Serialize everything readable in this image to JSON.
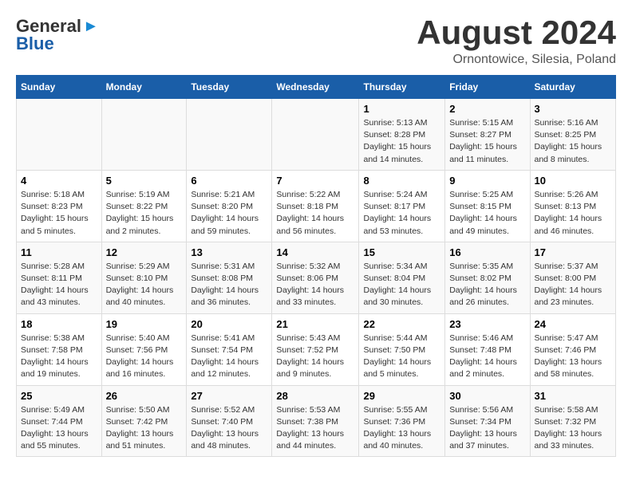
{
  "header": {
    "logo_general": "General",
    "logo_blue": "Blue",
    "month_year": "August 2024",
    "location": "Ornontowice, Silesia, Poland"
  },
  "days_of_week": [
    "Sunday",
    "Monday",
    "Tuesday",
    "Wednesday",
    "Thursday",
    "Friday",
    "Saturday"
  ],
  "weeks": [
    [
      {
        "day": "",
        "info": ""
      },
      {
        "day": "",
        "info": ""
      },
      {
        "day": "",
        "info": ""
      },
      {
        "day": "",
        "info": ""
      },
      {
        "day": "1",
        "info": "Sunrise: 5:13 AM\nSunset: 8:28 PM\nDaylight: 15 hours\nand 14 minutes."
      },
      {
        "day": "2",
        "info": "Sunrise: 5:15 AM\nSunset: 8:27 PM\nDaylight: 15 hours\nand 11 minutes."
      },
      {
        "day": "3",
        "info": "Sunrise: 5:16 AM\nSunset: 8:25 PM\nDaylight: 15 hours\nand 8 minutes."
      }
    ],
    [
      {
        "day": "4",
        "info": "Sunrise: 5:18 AM\nSunset: 8:23 PM\nDaylight: 15 hours\nand 5 minutes."
      },
      {
        "day": "5",
        "info": "Sunrise: 5:19 AM\nSunset: 8:22 PM\nDaylight: 15 hours\nand 2 minutes."
      },
      {
        "day": "6",
        "info": "Sunrise: 5:21 AM\nSunset: 8:20 PM\nDaylight: 14 hours\nand 59 minutes."
      },
      {
        "day": "7",
        "info": "Sunrise: 5:22 AM\nSunset: 8:18 PM\nDaylight: 14 hours\nand 56 minutes."
      },
      {
        "day": "8",
        "info": "Sunrise: 5:24 AM\nSunset: 8:17 PM\nDaylight: 14 hours\nand 53 minutes."
      },
      {
        "day": "9",
        "info": "Sunrise: 5:25 AM\nSunset: 8:15 PM\nDaylight: 14 hours\nand 49 minutes."
      },
      {
        "day": "10",
        "info": "Sunrise: 5:26 AM\nSunset: 8:13 PM\nDaylight: 14 hours\nand 46 minutes."
      }
    ],
    [
      {
        "day": "11",
        "info": "Sunrise: 5:28 AM\nSunset: 8:11 PM\nDaylight: 14 hours\nand 43 minutes."
      },
      {
        "day": "12",
        "info": "Sunrise: 5:29 AM\nSunset: 8:10 PM\nDaylight: 14 hours\nand 40 minutes."
      },
      {
        "day": "13",
        "info": "Sunrise: 5:31 AM\nSunset: 8:08 PM\nDaylight: 14 hours\nand 36 minutes."
      },
      {
        "day": "14",
        "info": "Sunrise: 5:32 AM\nSunset: 8:06 PM\nDaylight: 14 hours\nand 33 minutes."
      },
      {
        "day": "15",
        "info": "Sunrise: 5:34 AM\nSunset: 8:04 PM\nDaylight: 14 hours\nand 30 minutes."
      },
      {
        "day": "16",
        "info": "Sunrise: 5:35 AM\nSunset: 8:02 PM\nDaylight: 14 hours\nand 26 minutes."
      },
      {
        "day": "17",
        "info": "Sunrise: 5:37 AM\nSunset: 8:00 PM\nDaylight: 14 hours\nand 23 minutes."
      }
    ],
    [
      {
        "day": "18",
        "info": "Sunrise: 5:38 AM\nSunset: 7:58 PM\nDaylight: 14 hours\nand 19 minutes."
      },
      {
        "day": "19",
        "info": "Sunrise: 5:40 AM\nSunset: 7:56 PM\nDaylight: 14 hours\nand 16 minutes."
      },
      {
        "day": "20",
        "info": "Sunrise: 5:41 AM\nSunset: 7:54 PM\nDaylight: 14 hours\nand 12 minutes."
      },
      {
        "day": "21",
        "info": "Sunrise: 5:43 AM\nSunset: 7:52 PM\nDaylight: 14 hours\nand 9 minutes."
      },
      {
        "day": "22",
        "info": "Sunrise: 5:44 AM\nSunset: 7:50 PM\nDaylight: 14 hours\nand 5 minutes."
      },
      {
        "day": "23",
        "info": "Sunrise: 5:46 AM\nSunset: 7:48 PM\nDaylight: 14 hours\nand 2 minutes."
      },
      {
        "day": "24",
        "info": "Sunrise: 5:47 AM\nSunset: 7:46 PM\nDaylight: 13 hours\nand 58 minutes."
      }
    ],
    [
      {
        "day": "25",
        "info": "Sunrise: 5:49 AM\nSunset: 7:44 PM\nDaylight: 13 hours\nand 55 minutes."
      },
      {
        "day": "26",
        "info": "Sunrise: 5:50 AM\nSunset: 7:42 PM\nDaylight: 13 hours\nand 51 minutes."
      },
      {
        "day": "27",
        "info": "Sunrise: 5:52 AM\nSunset: 7:40 PM\nDaylight: 13 hours\nand 48 minutes."
      },
      {
        "day": "28",
        "info": "Sunrise: 5:53 AM\nSunset: 7:38 PM\nDaylight: 13 hours\nand 44 minutes."
      },
      {
        "day": "29",
        "info": "Sunrise: 5:55 AM\nSunset: 7:36 PM\nDaylight: 13 hours\nand 40 minutes."
      },
      {
        "day": "30",
        "info": "Sunrise: 5:56 AM\nSunset: 7:34 PM\nDaylight: 13 hours\nand 37 minutes."
      },
      {
        "day": "31",
        "info": "Sunrise: 5:58 AM\nSunset: 7:32 PM\nDaylight: 13 hours\nand 33 minutes."
      }
    ]
  ]
}
